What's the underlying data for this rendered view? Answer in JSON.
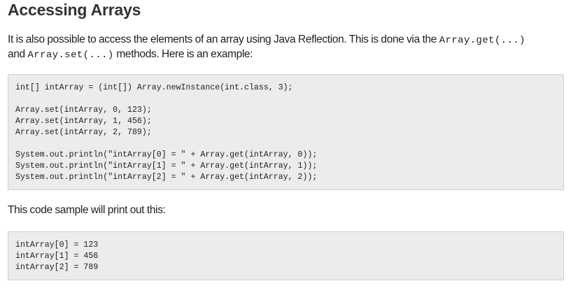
{
  "heading": "Accessing Arrays",
  "intro": {
    "text_1": "It is also possible to access the elements of an array using Java Reflection. This is done via the ",
    "code_1": "Array.get(...)",
    "text_2": "and ",
    "code_2": "Array.set(...)",
    "text_3": " methods. Here is an example:"
  },
  "code_example": {
    "lines": [
      "int[] intArray = (int[]) Array.newInstance(int.class, 3);",
      "",
      "Array.set(intArray, 0, 123);",
      "Array.set(intArray, 1, 456);",
      "Array.set(intArray, 2, 789);",
      "",
      "System.out.println(\"intArray[0] = \" + Array.get(intArray, 0));",
      "System.out.println(\"intArray[1] = \" + Array.get(intArray, 1));",
      "System.out.println(\"intArray[2] = \" + Array.get(intArray, 2));"
    ]
  },
  "outro": "This code sample will print out this:",
  "output_example": {
    "lines": [
      "intArray[0] = 123",
      "intArray[1] = 456",
      "intArray[2] = 789"
    ]
  }
}
